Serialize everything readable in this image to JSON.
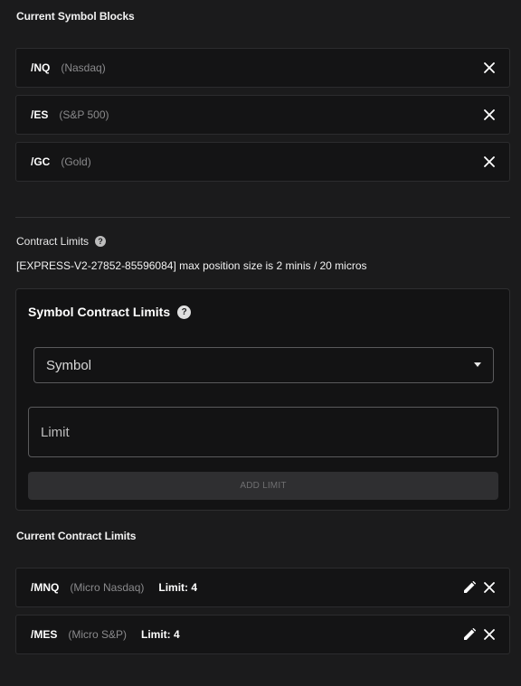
{
  "symbol_blocks": {
    "title": "Current Symbol Blocks",
    "items": [
      {
        "code": "/NQ",
        "name": "(Nasdaq)"
      },
      {
        "code": "/ES",
        "name": "(S&P 500)"
      },
      {
        "code": "/GC",
        "name": "(Gold)"
      }
    ]
  },
  "contract_limits": {
    "title": "Contract Limits",
    "help_glyph": "?",
    "account_note": "[EXPRESS-V2-27852-85596084] max position size is 2 minis / 20 micros"
  },
  "symbol_contract_limits": {
    "title": "Symbol Contract Limits",
    "help_glyph": "?",
    "symbol_select_label": "Symbol",
    "limit_placeholder": "Limit",
    "add_button_label": "ADD LIMIT"
  },
  "current_limits": {
    "title": "Current Contract Limits",
    "items": [
      {
        "code": "/MNQ",
        "name": "(Micro Nasdaq)",
        "limit": "Limit: 4"
      },
      {
        "code": "/MES",
        "name": "(Micro S&P)",
        "limit": "Limit: 4"
      }
    ]
  },
  "icons": {
    "remove": "close-icon",
    "edit": "pencil-icon",
    "help": "help-icon",
    "dropdown": "caret-down-icon"
  },
  "colors": {
    "background": "#1b1b1c",
    "row_background": "#141415",
    "muted_text": "#8a8a8c",
    "disabled_button": "#2f2f31"
  }
}
